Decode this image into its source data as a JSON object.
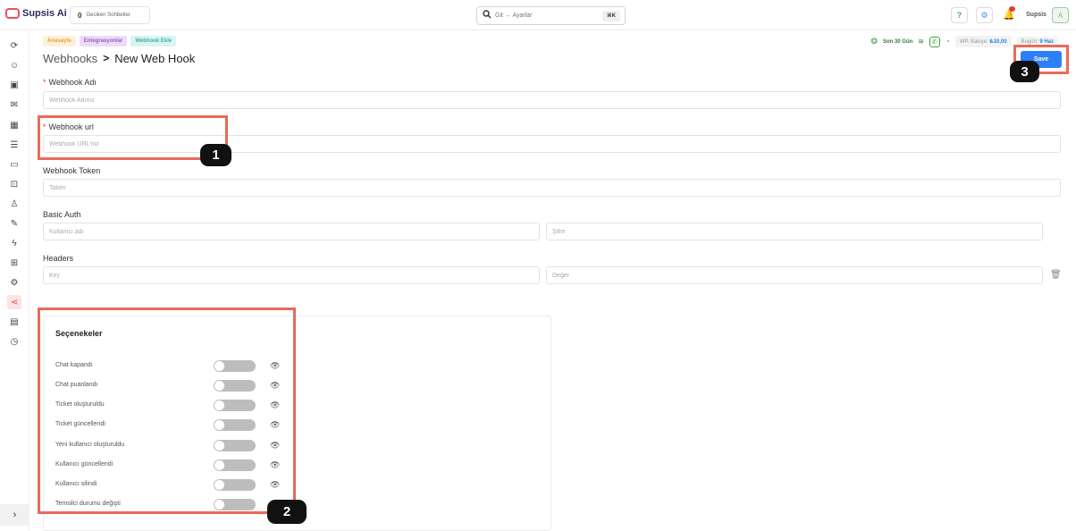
{
  "header": {
    "logo_text": "Supsis Ai",
    "delayed_count": "0",
    "delayed_label": "Geciken Sohbetler",
    "search_placeholder": "Git → Ayarlar",
    "search_shortcut": "⌘K",
    "user_name": "Supsis",
    "avatar_letter": "A"
  },
  "sidebar": {
    "icons": [
      "refresh-icon",
      "robot-icon",
      "chat-ai-icon",
      "mail-icon",
      "calendar-icon",
      "document-icon",
      "ticket-icon",
      "inbox-icon",
      "user-icon",
      "brush-icon",
      "lightning-icon",
      "grid-icon",
      "settings-icon",
      "share-icon",
      "cards-icon",
      "clock-icon"
    ],
    "active_index": 13,
    "expand_icon": "chevron-right-icon"
  },
  "breadcrumbs": [
    {
      "label": "Anasayfa",
      "color": "#f0a02a"
    },
    {
      "label": "Entegrasyonlar",
      "color": "#9b59c6"
    },
    {
      "label": "Webhook Ekle",
      "color": "#3fb0a1"
    }
  ],
  "stats": {
    "range": "Son 30 Gün",
    "balance_label": "WP. Bakiye:",
    "balance_value": "₺10,00",
    "today_label": "Bugün:",
    "today_value": "9 Haz"
  },
  "page": {
    "title_parent": "Webhooks",
    "title_separator": ">",
    "title_current": "New Web Hook",
    "save_label": "Save"
  },
  "form": {
    "name_label": "Webhook Adı",
    "name_placeholder": "Webhook Adınız",
    "url_label": "Webhook url",
    "url_placeholder": "Webhook URL'niz",
    "token_label": "Webhook Token",
    "token_placeholder": "Token",
    "auth_label": "Basic Auth",
    "auth_user_placeholder": "Kullanıcı adı",
    "auth_pass_placeholder": "Şifre",
    "headers_label": "Headers",
    "header_key_placeholder": "Key",
    "header_value_placeholder": "Değer"
  },
  "options": {
    "title": "Seçenekeler",
    "items": [
      {
        "label": "Chat kapandı",
        "enabled": false
      },
      {
        "label": "Chat puanlandı",
        "enabled": false
      },
      {
        "label": "Ticket oluşturuldu",
        "enabled": false
      },
      {
        "label": "Ticket güncellendi",
        "enabled": false
      },
      {
        "label": "Yeni kullanıcı oluşturuldu",
        "enabled": false
      },
      {
        "label": "Kullanıcı güncellendi",
        "enabled": false
      },
      {
        "label": "Kullanıcı silindi",
        "enabled": false
      },
      {
        "label": "Temsilci durumu değişti",
        "enabled": false
      }
    ]
  },
  "annotations": {
    "badge_1": "1",
    "badge_2": "2",
    "badge_3": "3",
    "highlight_color": "#ea6a5a"
  }
}
